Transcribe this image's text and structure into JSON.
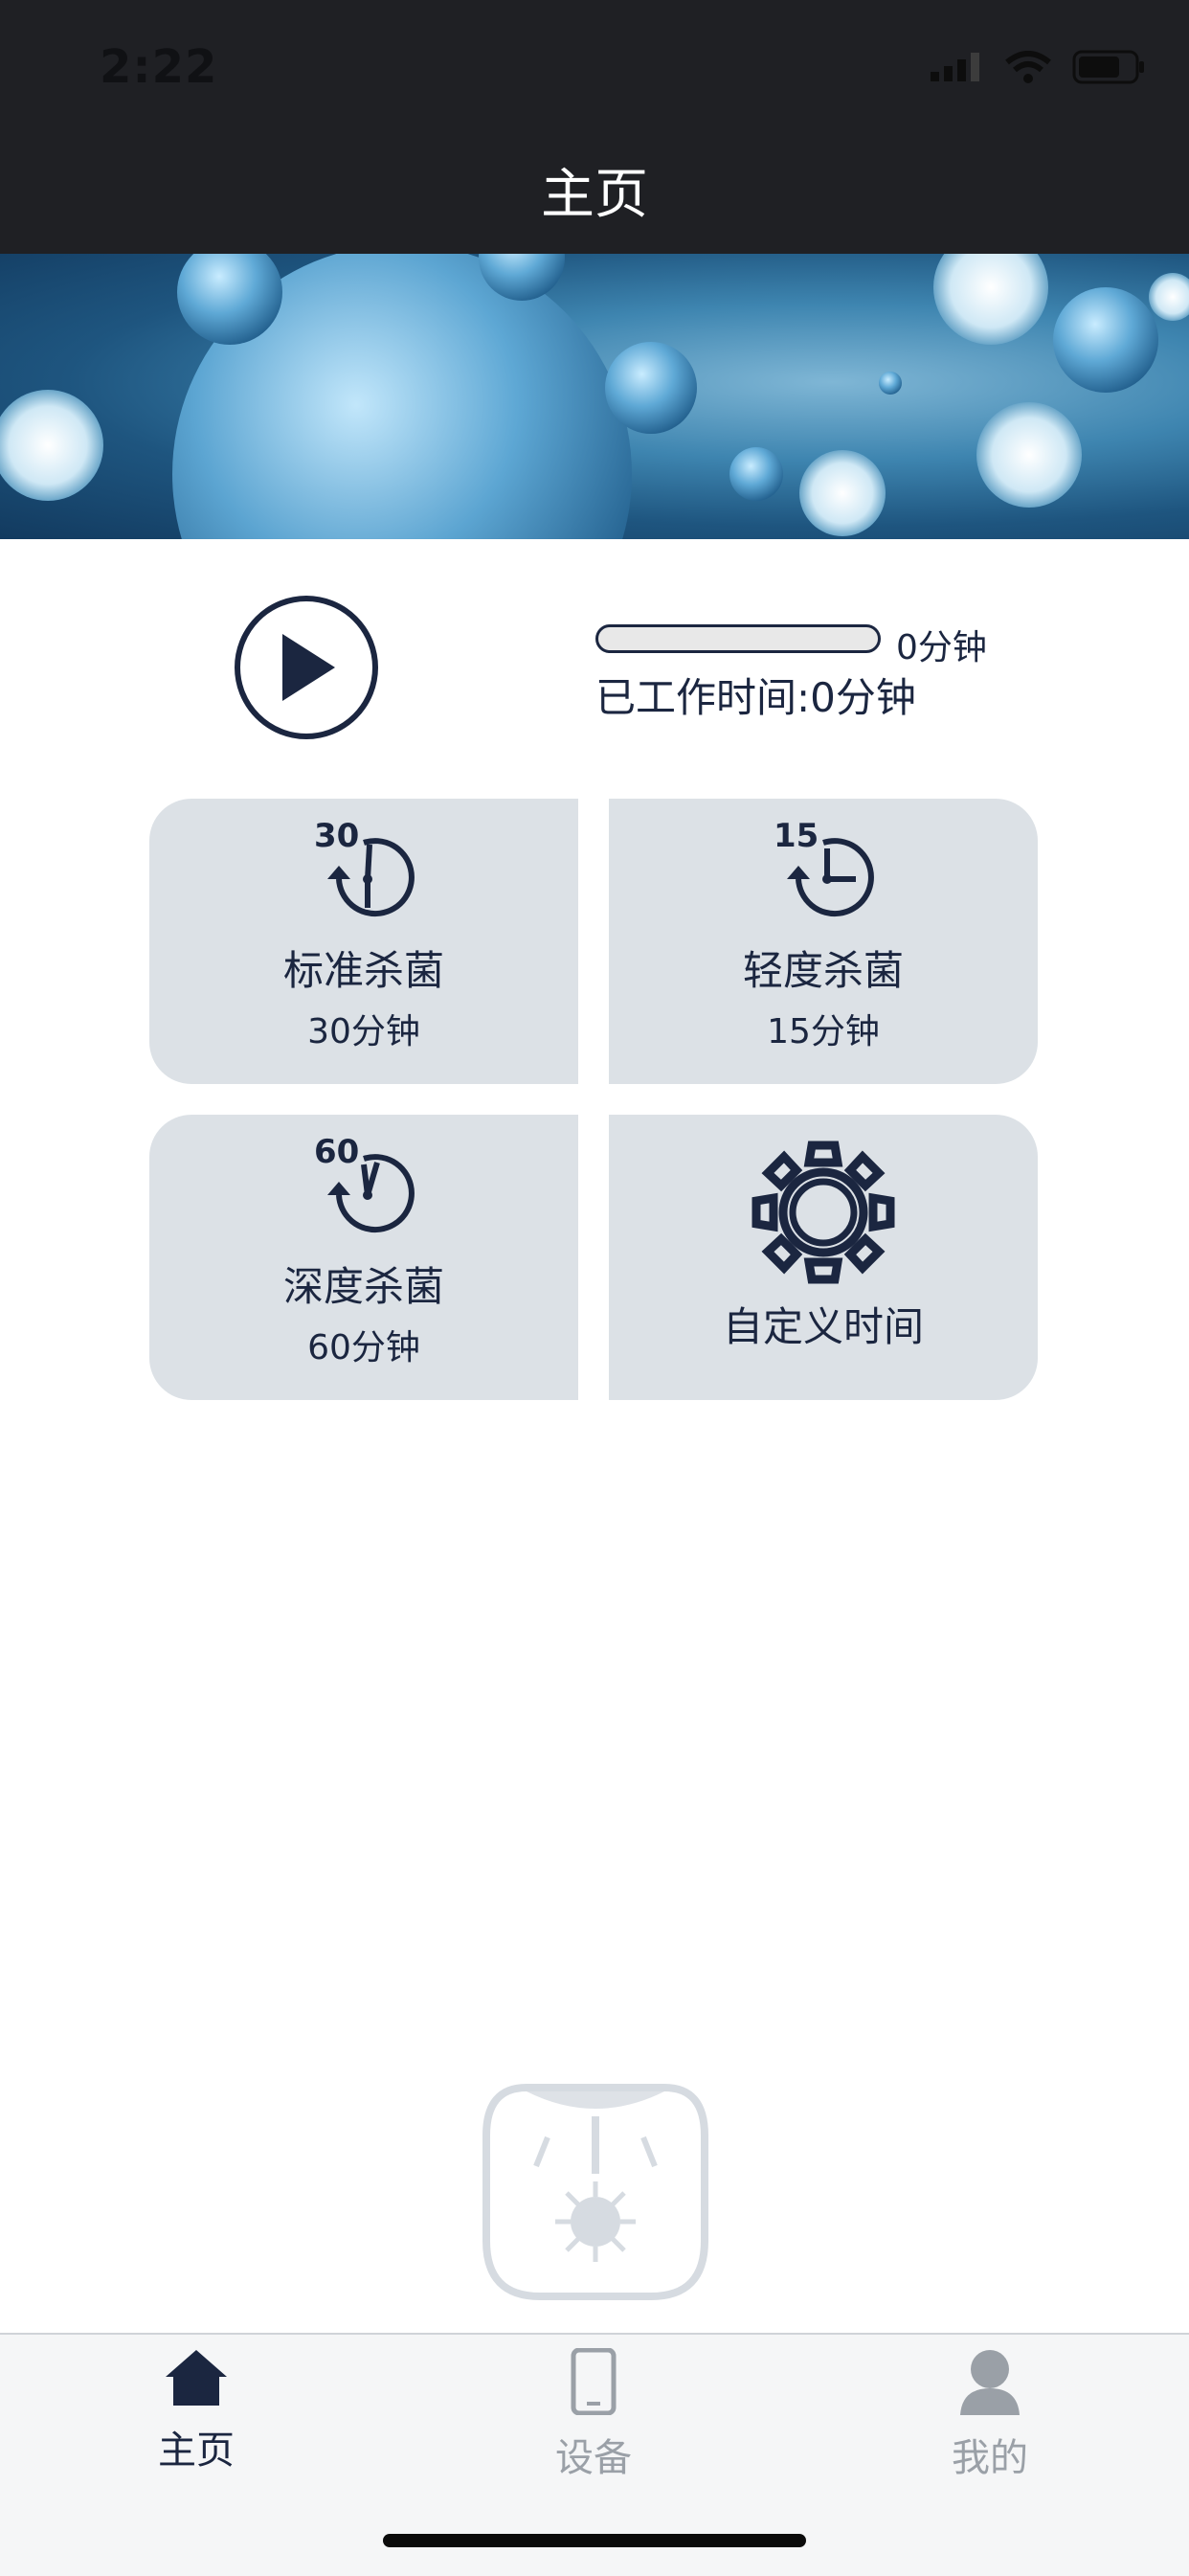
{
  "status_bar": {
    "time": "2:22"
  },
  "nav": {
    "title": "主页"
  },
  "player": {
    "progress_value_text": "0分钟",
    "progress_fraction": 0,
    "worked_time": "已工作时间:0分钟"
  },
  "modes": [
    {
      "badge": "30",
      "label": "标准杀菌",
      "duration": "30分钟",
      "icon": "clock-30-icon"
    },
    {
      "badge": "15",
      "label": "轻度杀菌",
      "duration": "15分钟",
      "icon": "clock-15-icon"
    },
    {
      "badge": "60",
      "label": "深度杀菌",
      "duration": "60分钟",
      "icon": "clock-60-icon"
    },
    {
      "label": "自定义时间",
      "icon": "gear-icon"
    }
  ],
  "tabs": [
    {
      "label": "主页",
      "icon": "home-icon",
      "active": true
    },
    {
      "label": "设备",
      "icon": "phone-icon",
      "active": false
    },
    {
      "label": "我的",
      "icon": "user-icon",
      "active": false
    }
  ],
  "colors": {
    "primary": "#1b2640",
    "bar": "#1f2024",
    "card": "#dce1e6",
    "tab_inactive": "#9aa0a7"
  }
}
